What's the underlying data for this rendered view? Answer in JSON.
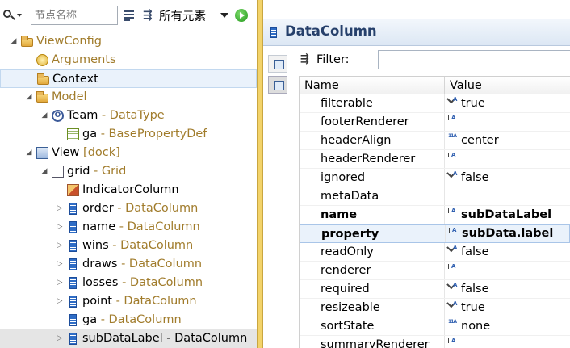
{
  "toolbar": {
    "search_placeholder": "节点名称",
    "filter_label": "所有元素"
  },
  "tree": [
    {
      "indent": 0,
      "toggle": "◢",
      "icon": "folder-open-icon",
      "icon_class": "ic-folder",
      "label": "ViewConfig",
      "type": "",
      "label_muted": true
    },
    {
      "indent": 1,
      "toggle": "",
      "icon": "arguments-icon",
      "icon_class": "ic-args",
      "label": "Arguments",
      "type": "",
      "label_muted": true
    },
    {
      "indent": 1,
      "toggle": "",
      "icon": "folder-open-icon",
      "icon_class": "ic-folder",
      "label": "Context",
      "type": "",
      "label_muted": false,
      "selected": true
    },
    {
      "indent": 1,
      "toggle": "◢",
      "icon": "folder-open-icon",
      "icon_class": "ic-folder",
      "label": "Model",
      "type": "",
      "label_muted": true
    },
    {
      "indent": 2,
      "toggle": "◢",
      "icon": "datatype-icon",
      "icon_class": "ic-type",
      "label": "Team",
      "type": " - DataType",
      "label_muted": false
    },
    {
      "indent": 3,
      "toggle": "",
      "icon": "property-def-icon",
      "icon_class": "ic-prop",
      "label": "ga",
      "type": " - BasePropertyDef",
      "label_muted": false
    },
    {
      "indent": 1,
      "toggle": "◢",
      "icon": "view-icon",
      "icon_class": "ic-view",
      "label": "View",
      "type": " [dock]",
      "label_muted": false
    },
    {
      "indent": 2,
      "toggle": "◢",
      "icon": "grid-icon",
      "icon_class": "ic-grid",
      "label": "grid",
      "type": " - Grid",
      "label_muted": false
    },
    {
      "indent": 3,
      "toggle": "",
      "icon": "indicator-column-icon",
      "icon_class": "ic-indicator",
      "label": "IndicatorColumn",
      "type": "",
      "label_muted": false
    },
    {
      "indent": 3,
      "toggle": "▷",
      "icon": "datacolumn-icon",
      "icon_class": "ic-col",
      "label": "order",
      "type": " - DataColumn",
      "label_muted": false
    },
    {
      "indent": 3,
      "toggle": "▷",
      "icon": "datacolumn-icon",
      "icon_class": "ic-col",
      "label": "name",
      "type": " - DataColumn",
      "label_muted": false
    },
    {
      "indent": 3,
      "toggle": "▷",
      "icon": "datacolumn-icon",
      "icon_class": "ic-col",
      "label": "wins",
      "type": " - DataColumn",
      "label_muted": false
    },
    {
      "indent": 3,
      "toggle": "▷",
      "icon": "datacolumn-icon",
      "icon_class": "ic-col",
      "label": "draws",
      "type": " - DataColumn",
      "label_muted": false
    },
    {
      "indent": 3,
      "toggle": "▷",
      "icon": "datacolumn-icon",
      "icon_class": "ic-col",
      "label": "losses",
      "type": " - DataColumn",
      "label_muted": false
    },
    {
      "indent": 3,
      "toggle": "▷",
      "icon": "datacolumn-icon",
      "icon_class": "ic-col",
      "label": "point",
      "type": " - DataColumn",
      "label_muted": false
    },
    {
      "indent": 3,
      "toggle": "",
      "icon": "datacolumn-icon",
      "icon_class": "ic-col",
      "label": "ga",
      "type": " - DataColumn",
      "label_muted": false
    },
    {
      "indent": 3,
      "toggle": "▷",
      "icon": "datacolumn-icon",
      "icon_class": "ic-col",
      "label": "subDataLabel",
      "type": " - DataColumn",
      "label_muted": false,
      "hovered": true,
      "type_plain": true
    }
  ],
  "editor": {
    "title": "DataColumn",
    "filter_label": "Filter:",
    "filter_value": "",
    "col_name": "Name",
    "col_value": "Value"
  },
  "properties": [
    {
      "name": "filterable",
      "icon": "ic-bool",
      "value": "true"
    },
    {
      "name": "footerRenderer",
      "icon": "ic-str",
      "value": ""
    },
    {
      "name": "headerAlign",
      "icon": "ic-int",
      "value": "center"
    },
    {
      "name": "headerRenderer",
      "icon": "ic-str",
      "value": ""
    },
    {
      "name": "ignored",
      "icon": "ic-bool",
      "value": "false"
    },
    {
      "name": "metaData",
      "icon": "",
      "value": ""
    },
    {
      "name": "name",
      "icon": "ic-str",
      "value": "subDataLabel",
      "bold": true
    },
    {
      "name": "property",
      "icon": "ic-str",
      "value": "subData.label",
      "bold": true,
      "selected": true
    },
    {
      "name": "readOnly",
      "icon": "ic-bool",
      "value": "false"
    },
    {
      "name": "renderer",
      "icon": "ic-str",
      "value": ""
    },
    {
      "name": "required",
      "icon": "ic-bool",
      "value": "false"
    },
    {
      "name": "resizeable",
      "icon": "ic-bool",
      "value": "true"
    },
    {
      "name": "sortState",
      "icon": "ic-int",
      "value": "none"
    },
    {
      "name": "summaryRenderer",
      "icon": "ic-str",
      "value": ""
    }
  ]
}
